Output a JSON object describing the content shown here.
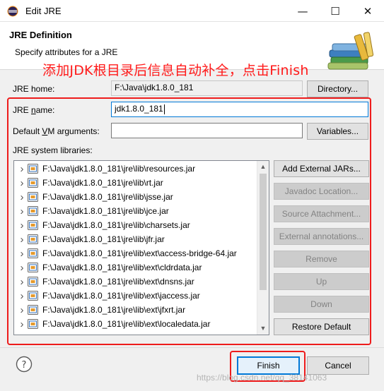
{
  "window": {
    "title": "Edit JRE",
    "minimize_glyph": "—",
    "maximize_glyph": "☐",
    "close_glyph": "✕"
  },
  "header": {
    "title": "JRE Definition",
    "subtitle": "Specify attributes for a JRE"
  },
  "annotation": "添加JDK根目录后信息自动补全，点击Finish",
  "form": {
    "jre_home_label": "JRE home:",
    "jre_home_value": "F:\\Java\\jdk1.8.0_181",
    "directory_button": "Directory...",
    "jre_name_label_prefix": "JRE ",
    "jre_name_label_ul": "n",
    "jre_name_label_suffix": "ame:",
    "jre_name_value": "jdk1.8.0_181",
    "vm_args_label_prefix": "Default ",
    "vm_args_label_ul": "V",
    "vm_args_label_suffix": "M arguments:",
    "vm_args_value": "",
    "variables_button": "Variables...",
    "libraries_label": "JRE system libraries:"
  },
  "libraries": [
    "F:\\Java\\jdk1.8.0_181\\jre\\lib\\resources.jar",
    "F:\\Java\\jdk1.8.0_181\\jre\\lib\\rt.jar",
    "F:\\Java\\jdk1.8.0_181\\jre\\lib\\jsse.jar",
    "F:\\Java\\jdk1.8.0_181\\jre\\lib\\jce.jar",
    "F:\\Java\\jdk1.8.0_181\\jre\\lib\\charsets.jar",
    "F:\\Java\\jdk1.8.0_181\\jre\\lib\\jfr.jar",
    "F:\\Java\\jdk1.8.0_181\\jre\\lib\\ext\\access-bridge-64.jar",
    "F:\\Java\\jdk1.8.0_181\\jre\\lib\\ext\\cldrdata.jar",
    "F:\\Java\\jdk1.8.0_181\\jre\\lib\\ext\\dnsns.jar",
    "F:\\Java\\jdk1.8.0_181\\jre\\lib\\ext\\jaccess.jar",
    "F:\\Java\\jdk1.8.0_181\\jre\\lib\\ext\\jfxrt.jar",
    "F:\\Java\\jdk1.8.0_181\\jre\\lib\\ext\\localedata.jar"
  ],
  "library_buttons": {
    "add_external_jars": "Add External JARs...",
    "javadoc_location": "Javadoc Location...",
    "source_attachment": "Source Attachment...",
    "external_annotations": "External annotations...",
    "remove": "Remove",
    "up": "Up",
    "down": "Down",
    "restore_default": "Restore Default"
  },
  "footer": {
    "finish": "Finish",
    "cancel": "Cancel",
    "watermark": "https://blog.csdn.net/qq_38141063"
  },
  "colors": {
    "annotation_red": "#ee1c1c",
    "focus_blue": "#0078d7",
    "dialog_bg": "#f0f0f0"
  }
}
